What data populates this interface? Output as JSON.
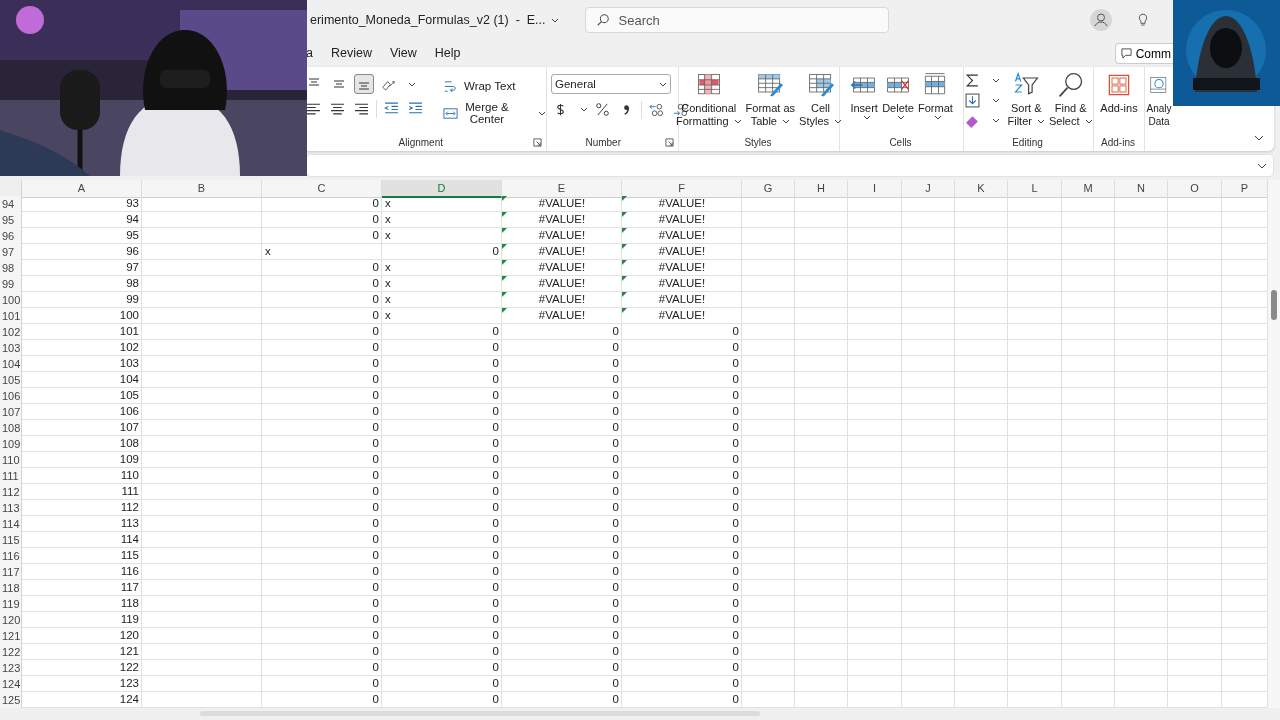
{
  "title_bar": {
    "document_title": "erimento_Moneda_Formulas_v2 (1)  -  E...",
    "search_placeholder": "Search"
  },
  "ribbon_tabs": [
    {
      "label": "a",
      "selected": false
    },
    {
      "label": "Review",
      "selected": false
    },
    {
      "label": "View",
      "selected": false
    },
    {
      "label": "Help",
      "selected": false
    }
  ],
  "comments_button": {
    "label": "Comm"
  },
  "ribbon": {
    "alignment": {
      "label": "Alignment",
      "wrap_text": "Wrap Text",
      "merge_center": "Merge & Center",
      "vertical_align": [
        {
          "selected": false
        },
        {
          "selected": false
        },
        {
          "selected": true
        }
      ]
    },
    "number": {
      "label": "Number",
      "format": "General"
    },
    "styles": {
      "label": "Styles",
      "buttons": [
        {
          "lines": [
            "Conditional",
            "Formatting"
          ]
        },
        {
          "lines": [
            "Format as",
            "Table"
          ]
        },
        {
          "lines": [
            "Cell",
            "Styles"
          ]
        }
      ]
    },
    "cells": {
      "label": "Cells",
      "buttons": [
        {
          "lines": [
            "Insert"
          ]
        },
        {
          "lines": [
            "Delete"
          ]
        },
        {
          "lines": [
            "Format"
          ]
        }
      ]
    },
    "editing": {
      "label": "Editing",
      "buttons": [
        {
          "lines": [
            "Sort &",
            "Filter"
          ]
        },
        {
          "lines": [
            "Find &",
            "Select"
          ]
        }
      ]
    },
    "addins": {
      "label": "Add-ins",
      "buttons": [
        {
          "lines": [
            "Add-ins"
          ]
        }
      ]
    },
    "analyze": {
      "buttons": [
        {
          "lines": [
            "Analy",
            "Data"
          ]
        }
      ]
    }
  },
  "sheet": {
    "columns": [
      {
        "label": "A",
        "selected": false
      },
      {
        "label": "B",
        "selected": false
      },
      {
        "label": "C",
        "selected": false
      },
      {
        "label": "D",
        "selected": true
      },
      {
        "label": "E",
        "selected": false
      },
      {
        "label": "F",
        "selected": false
      },
      {
        "label": "G",
        "selected": false
      },
      {
        "label": "H",
        "selected": false
      },
      {
        "label": "I",
        "selected": false
      },
      {
        "label": "J",
        "selected": false
      },
      {
        "label": "K",
        "selected": false
      },
      {
        "label": "L",
        "selected": false
      },
      {
        "label": "M",
        "selected": false
      },
      {
        "label": "N",
        "selected": false
      },
      {
        "label": "O",
        "selected": false
      },
      {
        "label": "P",
        "selected": false
      }
    ],
    "rows": [
      {
        "header": "94",
        "cells": [
          {
            "text": "93",
            "number": true
          },
          {},
          {
            "text": "0",
            "number": true
          },
          {
            "text": "x",
            "number": false
          },
          {
            "text": "#VALUE!",
            "number": false,
            "flagged": true
          },
          {
            "text": "#VALUE!",
            "number": false,
            "flagged": true
          }
        ]
      },
      {
        "header": "95",
        "cells": [
          {
            "text": "94",
            "number": true
          },
          {},
          {
            "text": "0",
            "number": true
          },
          {
            "text": "x",
            "number": false
          },
          {
            "text": "#VALUE!",
            "number": false,
            "flagged": true
          },
          {
            "text": "#VALUE!",
            "number": false,
            "flagged": true
          }
        ]
      },
      {
        "header": "96",
        "cells": [
          {
            "text": "95",
            "number": true
          },
          {},
          {
            "text": "0",
            "number": true
          },
          {
            "text": "x",
            "number": false
          },
          {
            "text": "#VALUE!",
            "number": false,
            "flagged": true
          },
          {
            "text": "#VALUE!",
            "number": false,
            "flagged": true
          }
        ]
      },
      {
        "header": "97",
        "cells": [
          {
            "text": "96",
            "number": true
          },
          {},
          {
            "text": "x",
            "number": false
          },
          {
            "text": "0",
            "number": true
          },
          {
            "text": "#VALUE!",
            "number": false,
            "flagged": true
          },
          {
            "text": "#VALUE!",
            "number": false,
            "flagged": true
          }
        ]
      },
      {
        "header": "98",
        "cells": [
          {
            "text": "97",
            "number": true
          },
          {},
          {
            "text": "0",
            "number": true
          },
          {
            "text": "x",
            "number": false
          },
          {
            "text": "#VALUE!",
            "number": false,
            "flagged": true
          },
          {
            "text": "#VALUE!",
            "number": false,
            "flagged": true
          }
        ]
      },
      {
        "header": "99",
        "cells": [
          {
            "text": "98",
            "number": true
          },
          {},
          {
            "text": "0",
            "number": true
          },
          {
            "text": "x",
            "number": false
          },
          {
            "text": "#VALUE!",
            "number": false,
            "flagged": true
          },
          {
            "text": "#VALUE!",
            "number": false,
            "flagged": true
          }
        ]
      },
      {
        "header": "100",
        "cells": [
          {
            "text": "99",
            "number": true
          },
          {},
          {
            "text": "0",
            "number": true
          },
          {
            "text": "x",
            "number": false
          },
          {
            "text": "#VALUE!",
            "number": false,
            "flagged": true
          },
          {
            "text": "#VALUE!",
            "number": false,
            "flagged": true
          }
        ]
      },
      {
        "header": "101",
        "cells": [
          {
            "text": "100",
            "number": true
          },
          {},
          {
            "text": "0",
            "number": true
          },
          {
            "text": "x",
            "number": false
          },
          {
            "text": "#VALUE!",
            "number": false,
            "flagged": true
          },
          {
            "text": "#VALUE!",
            "number": false,
            "flagged": true
          }
        ]
      },
      {
        "header": "102",
        "cells": [
          {
            "text": "101",
            "number": true
          },
          {},
          {
            "text": "0",
            "number": true
          },
          {
            "text": "0",
            "number": true
          },
          {
            "text": "0",
            "number": true
          },
          {
            "text": "0",
            "number": true
          }
        ]
      },
      {
        "header": "103",
        "cells": [
          {
            "text": "102",
            "number": true
          },
          {},
          {
            "text": "0",
            "number": true
          },
          {
            "text": "0",
            "number": true
          },
          {
            "text": "0",
            "number": true
          },
          {
            "text": "0",
            "number": true
          }
        ]
      },
      {
        "header": "104",
        "cells": [
          {
            "text": "103",
            "number": true
          },
          {},
          {
            "text": "0",
            "number": true
          },
          {
            "text": "0",
            "number": true
          },
          {
            "text": "0",
            "number": true
          },
          {
            "text": "0",
            "number": true
          }
        ]
      },
      {
        "header": "105",
        "cells": [
          {
            "text": "104",
            "number": true
          },
          {},
          {
            "text": "0",
            "number": true
          },
          {
            "text": "0",
            "number": true
          },
          {
            "text": "0",
            "number": true
          },
          {
            "text": "0",
            "number": true
          }
        ]
      },
      {
        "header": "106",
        "cells": [
          {
            "text": "105",
            "number": true
          },
          {},
          {
            "text": "0",
            "number": true
          },
          {
            "text": "0",
            "number": true
          },
          {
            "text": "0",
            "number": true
          },
          {
            "text": "0",
            "number": true
          }
        ]
      },
      {
        "header": "107",
        "cells": [
          {
            "text": "106",
            "number": true
          },
          {},
          {
            "text": "0",
            "number": true
          },
          {
            "text": "0",
            "number": true
          },
          {
            "text": "0",
            "number": true
          },
          {
            "text": "0",
            "number": true
          }
        ]
      },
      {
        "header": "108",
        "cells": [
          {
            "text": "107",
            "number": true
          },
          {},
          {
            "text": "0",
            "number": true
          },
          {
            "text": "0",
            "number": true
          },
          {
            "text": "0",
            "number": true
          },
          {
            "text": "0",
            "number": true
          }
        ]
      },
      {
        "header": "109",
        "cells": [
          {
            "text": "108",
            "number": true
          },
          {},
          {
            "text": "0",
            "number": true
          },
          {
            "text": "0",
            "number": true
          },
          {
            "text": "0",
            "number": true
          },
          {
            "text": "0",
            "number": true
          }
        ]
      },
      {
        "header": "110",
        "cells": [
          {
            "text": "109",
            "number": true
          },
          {},
          {
            "text": "0",
            "number": true
          },
          {
            "text": "0",
            "number": true
          },
          {
            "text": "0",
            "number": true
          },
          {
            "text": "0",
            "number": true
          }
        ]
      },
      {
        "header": "111",
        "cells": [
          {
            "text": "110",
            "number": true
          },
          {},
          {
            "text": "0",
            "number": true
          },
          {
            "text": "0",
            "number": true
          },
          {
            "text": "0",
            "number": true
          },
          {
            "text": "0",
            "number": true
          }
        ]
      },
      {
        "header": "112",
        "cells": [
          {
            "text": "111",
            "number": true
          },
          {},
          {
            "text": "0",
            "number": true
          },
          {
            "text": "0",
            "number": true
          },
          {
            "text": "0",
            "number": true
          },
          {
            "text": "0",
            "number": true
          }
        ]
      },
      {
        "header": "113",
        "cells": [
          {
            "text": "112",
            "number": true
          },
          {},
          {
            "text": "0",
            "number": true
          },
          {
            "text": "0",
            "number": true
          },
          {
            "text": "0",
            "number": true
          },
          {
            "text": "0",
            "number": true
          }
        ]
      },
      {
        "header": "114",
        "cells": [
          {
            "text": "113",
            "number": true
          },
          {},
          {
            "text": "0",
            "number": true
          },
          {
            "text": "0",
            "number": true
          },
          {
            "text": "0",
            "number": true
          },
          {
            "text": "0",
            "number": true
          }
        ]
      },
      {
        "header": "115",
        "cells": [
          {
            "text": "114",
            "number": true
          },
          {},
          {
            "text": "0",
            "number": true
          },
          {
            "text": "0",
            "number": true
          },
          {
            "text": "0",
            "number": true
          },
          {
            "text": "0",
            "number": true
          }
        ]
      },
      {
        "header": "116",
        "cells": [
          {
            "text": "115",
            "number": true
          },
          {},
          {
            "text": "0",
            "number": true
          },
          {
            "text": "0",
            "number": true
          },
          {
            "text": "0",
            "number": true
          },
          {
            "text": "0",
            "number": true
          }
        ]
      },
      {
        "header": "117",
        "cells": [
          {
            "text": "116",
            "number": true
          },
          {},
          {
            "text": "0",
            "number": true
          },
          {
            "text": "0",
            "number": true
          },
          {
            "text": "0",
            "number": true
          },
          {
            "text": "0",
            "number": true
          }
        ]
      },
      {
        "header": "118",
        "cells": [
          {
            "text": "117",
            "number": true
          },
          {},
          {
            "text": "0",
            "number": true
          },
          {
            "text": "0",
            "number": true
          },
          {
            "text": "0",
            "number": true
          },
          {
            "text": "0",
            "number": true
          }
        ]
      },
      {
        "header": "119",
        "cells": [
          {
            "text": "118",
            "number": true
          },
          {},
          {
            "text": "0",
            "number": true
          },
          {
            "text": "0",
            "number": true
          },
          {
            "text": "0",
            "number": true
          },
          {
            "text": "0",
            "number": true
          }
        ]
      },
      {
        "header": "120",
        "cells": [
          {
            "text": "119",
            "number": true
          },
          {},
          {
            "text": "0",
            "number": true
          },
          {
            "text": "0",
            "number": true
          },
          {
            "text": "0",
            "number": true
          },
          {
            "text": "0",
            "number": true
          }
        ]
      },
      {
        "header": "121",
        "cells": [
          {
            "text": "120",
            "number": true
          },
          {},
          {
            "text": "0",
            "number": true
          },
          {
            "text": "0",
            "number": true
          },
          {
            "text": "0",
            "number": true
          },
          {
            "text": "0",
            "number": true
          }
        ]
      },
      {
        "header": "122",
        "cells": [
          {
            "text": "121",
            "number": true
          },
          {},
          {
            "text": "0",
            "number": true
          },
          {
            "text": "0",
            "number": true
          },
          {
            "text": "0",
            "number": true
          },
          {
            "text": "0",
            "number": true
          }
        ]
      },
      {
        "header": "123",
        "cells": [
          {
            "text": "122",
            "number": true
          },
          {},
          {
            "text": "0",
            "number": true
          },
          {
            "text": "0",
            "number": true
          },
          {
            "text": "0",
            "number": true
          },
          {
            "text": "0",
            "number": true
          }
        ]
      },
      {
        "header": "124",
        "cells": [
          {
            "text": "123",
            "number": true
          },
          {},
          {
            "text": "0",
            "number": true
          },
          {
            "text": "0",
            "number": true
          },
          {
            "text": "0",
            "number": true
          },
          {
            "text": "0",
            "number": true
          }
        ]
      },
      {
        "header": "125",
        "cells": [
          {
            "text": "124",
            "number": true
          },
          {},
          {
            "text": "0",
            "number": true
          },
          {
            "text": "0",
            "number": true
          },
          {
            "text": "0",
            "number": true
          },
          {
            "text": "0",
            "number": true
          }
        ]
      }
    ]
  }
}
